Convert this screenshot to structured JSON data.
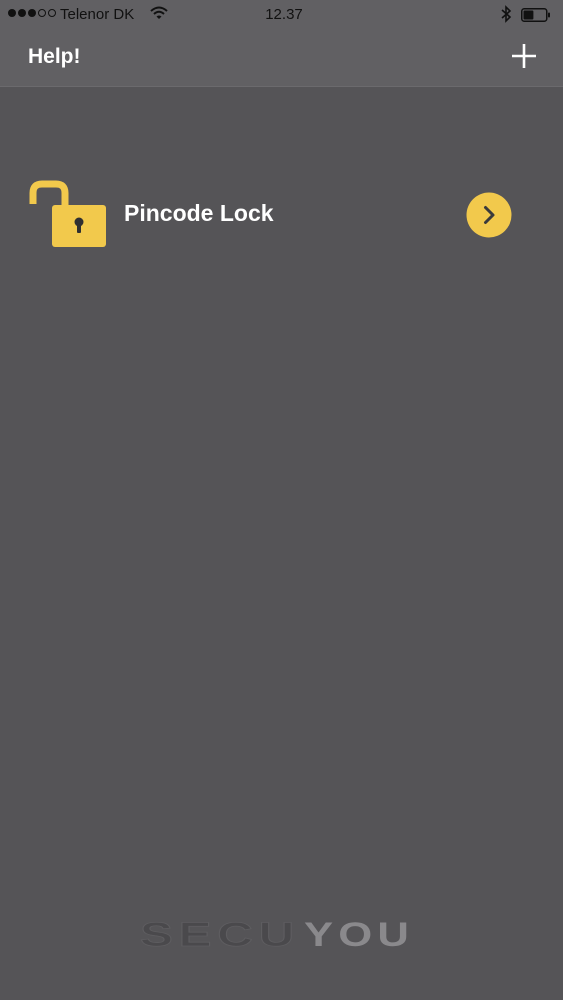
{
  "status_bar": {
    "carrier": "Telenor DK",
    "time": "12.37",
    "signal_filled": 3,
    "signal_total": 5,
    "battery_level": 0.45
  },
  "header": {
    "help_label": "Help!",
    "add_icon": "plus-icon"
  },
  "locks": [
    {
      "name": "Pincode Lock",
      "state": "unlocked",
      "icon": "padlock-open-icon",
      "action_icon": "chevron-right-icon"
    }
  ],
  "footer": {
    "logo_text_part1": "SECU",
    "logo_text_part2": "YOU"
  },
  "colors": {
    "background": "#555457",
    "header_background": "#616063",
    "accent_yellow": "#f2c94c",
    "text_white": "#ffffff"
  }
}
